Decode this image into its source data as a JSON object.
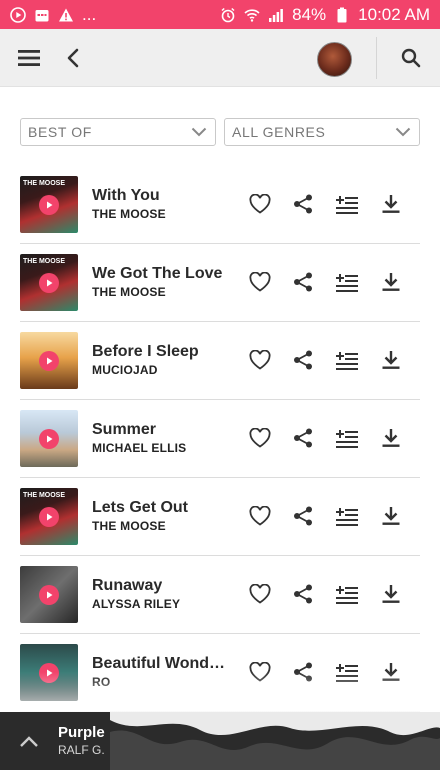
{
  "status_bar": {
    "battery": "84%",
    "time": "10:02 AM",
    "more": "..."
  },
  "app_bar": {
    "menu_icon": "menu-icon",
    "back_icon": "back-arrow-icon",
    "search_icon": "search-icon"
  },
  "filters": {
    "chart": "BEST OF",
    "genre": "ALL GENRES"
  },
  "tracks": [
    {
      "title": "With You",
      "artist": "THE MOOSE",
      "art": "moose"
    },
    {
      "title": "We Got The Love",
      "artist": "THE MOOSE",
      "art": "moose"
    },
    {
      "title": "Before I Sleep",
      "artist": "MUCIOJAD",
      "art": "sunset"
    },
    {
      "title": "Summer",
      "artist": "MICHAEL ELLIS",
      "art": "beach"
    },
    {
      "title": "Lets Get Out",
      "artist": "THE MOOSE",
      "art": "moose"
    },
    {
      "title": "Runaway",
      "artist": "ALYSSA RILEY",
      "art": "dark"
    },
    {
      "title": "Beautiful Wonde...",
      "artist": "RO",
      "art": "teal"
    }
  ],
  "art_label": "THE MOOSE",
  "now_playing": {
    "title": "Purple",
    "artist": "RALF G."
  },
  "colors": {
    "accent": "#f2436b",
    "player_bg": "#2b2b2b",
    "appbar_bg": "#efefef"
  }
}
